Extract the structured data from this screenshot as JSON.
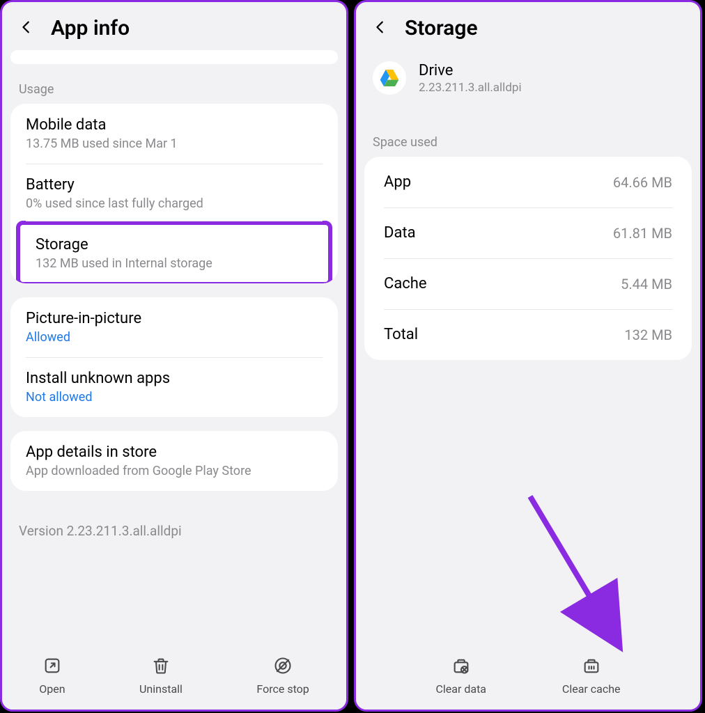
{
  "left": {
    "title": "App info",
    "section_usage": "Usage",
    "mobile_data": {
      "label": "Mobile data",
      "sub": "13.75 MB used since Mar 1"
    },
    "battery": {
      "label": "Battery",
      "sub": "0% used since last fully charged"
    },
    "storage": {
      "label": "Storage",
      "sub": "132 MB used in Internal storage"
    },
    "pip": {
      "label": "Picture-in-picture",
      "sub": "Allowed"
    },
    "unknown": {
      "label": "Install unknown apps",
      "sub": "Not allowed"
    },
    "details": {
      "label": "App details in store",
      "sub": "App downloaded from Google Play Store"
    },
    "version": "Version 2.23.211.3.all.alldpi",
    "buttons": {
      "open": "Open",
      "uninstall": "Uninstall",
      "force_stop": "Force stop"
    }
  },
  "right": {
    "title": "Storage",
    "app_name": "Drive",
    "app_version": "2.23.211.3.all.alldpi",
    "section_space": "Space used",
    "rows": {
      "app": {
        "label": "App",
        "value": "64.66 MB"
      },
      "data": {
        "label": "Data",
        "value": "61.81 MB"
      },
      "cache": {
        "label": "Cache",
        "value": "5.44 MB"
      },
      "total": {
        "label": "Total",
        "value": "132 MB"
      }
    },
    "buttons": {
      "clear_data": "Clear data",
      "clear_cache": "Clear cache"
    }
  }
}
